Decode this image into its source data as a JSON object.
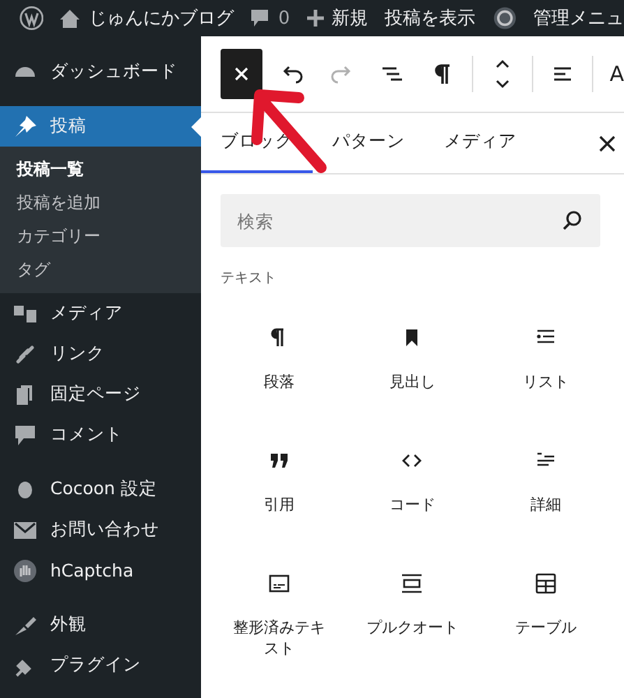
{
  "admin_bar": {
    "site_name": "じゅんにかブログ",
    "comments": "0",
    "new": "新規",
    "view_post": "投稿を表示",
    "admin_menu": "管理メニュ"
  },
  "sidebar": {
    "items": [
      {
        "label": "ダッシュボード",
        "selected": false
      },
      {
        "label": "投稿",
        "selected": true,
        "children": [
          {
            "label": "投稿一覧",
            "selected": true
          },
          {
            "label": "投稿を追加",
            "selected": false
          },
          {
            "label": "カテゴリー",
            "selected": false
          },
          {
            "label": "タグ",
            "selected": false
          }
        ]
      },
      {
        "label": "メディア",
        "selected": false
      },
      {
        "label": "リンク",
        "selected": false
      },
      {
        "label": "固定ページ",
        "selected": false
      },
      {
        "label": "コメント",
        "selected": false
      },
      {
        "label": "Cocoon 設定",
        "selected": false
      },
      {
        "label": "お問い合わせ",
        "selected": false
      },
      {
        "label": "hCaptcha",
        "selected": false
      },
      {
        "label": "外観",
        "selected": false
      },
      {
        "label": "プラグイン",
        "selected": false
      }
    ]
  },
  "toolbar": {
    "tools": [
      {
        "kind": "close",
        "disabled": false
      },
      {
        "kind": "undo",
        "disabled": false
      },
      {
        "kind": "redo",
        "disabled": true
      },
      {
        "kind": "listview",
        "disabled": false
      },
      {
        "kind": "pilcrow",
        "disabled": false
      },
      {
        "kind": "updown",
        "disabled": false
      },
      {
        "kind": "align",
        "disabled": false
      }
    ],
    "text_tool": "A"
  },
  "inserter": {
    "tabs": [
      {
        "label": "ブロック",
        "selected": true
      },
      {
        "label": "パターン",
        "selected": false
      },
      {
        "label": "メディア",
        "selected": false
      }
    ],
    "search": {
      "placeholder": "検索"
    },
    "section": "テキスト",
    "blocks": [
      {
        "label": "段落"
      },
      {
        "label": "見出し"
      },
      {
        "label": "リスト"
      },
      {
        "label": "引用"
      },
      {
        "label": "コード"
      },
      {
        "label": "詳細"
      },
      {
        "label": "整形済みテキスト"
      },
      {
        "label": "プルクオート"
      },
      {
        "label": "テーブル"
      }
    ]
  }
}
